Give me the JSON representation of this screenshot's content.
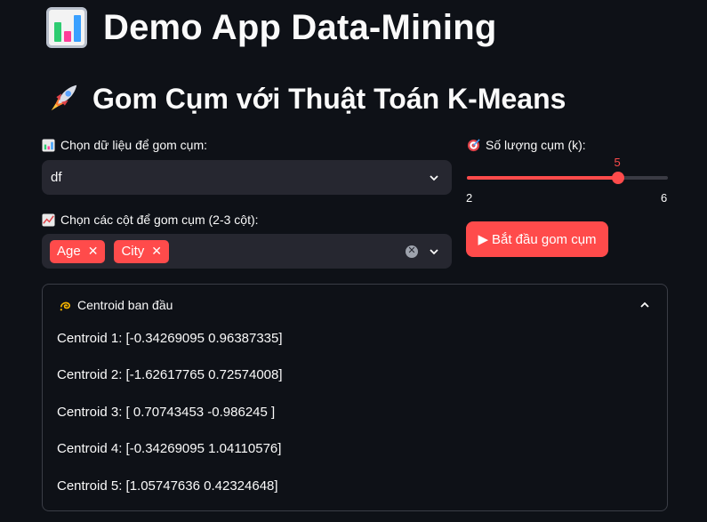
{
  "app": {
    "title": "Demo App Data-Mining"
  },
  "section": {
    "title": "Gom Cụm với Thuật Toán K-Means"
  },
  "data_select": {
    "label": "Chọn dữ liệu để gom cụm:",
    "value": "df"
  },
  "columns_select": {
    "label": "Chọn các cột để gom cụm (2-3 cột):",
    "tags": [
      "Age",
      "City"
    ]
  },
  "slider": {
    "label": "Số lượng cụm (k):",
    "value": "5",
    "min": "2",
    "max": "6",
    "fill_fraction": 0.75
  },
  "start_button": {
    "label": "Bắt đầu gom cụm",
    "icon": "play-icon"
  },
  "expander": {
    "title": "Centroid ban đầu",
    "items": [
      "Centroid 1: [-0.34269095 0.96387335]",
      "Centroid 2: [-1.62617765 0.72574008]",
      "Centroid 3: [ 0.70743453 -0.986245 ]",
      "Centroid 4: [-0.34269095 1.04110576]",
      "Centroid 5: [1.05747636 0.42324648]"
    ]
  },
  "colors": {
    "accent": "#ff4b4b",
    "background": "#0e1117",
    "input_bg": "#262730"
  }
}
